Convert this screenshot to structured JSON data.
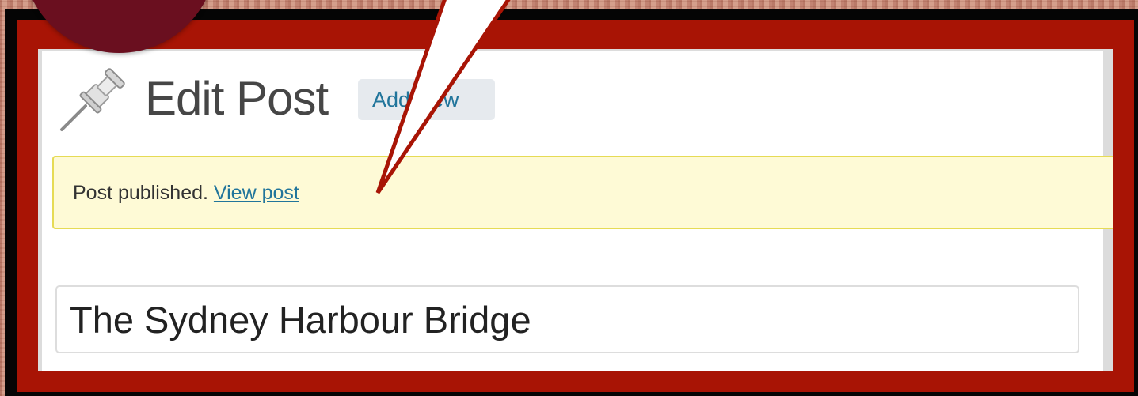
{
  "header": {
    "title": "Edit Post",
    "add_new_label": "Add New",
    "icon": "pushpin-icon"
  },
  "notice": {
    "message": "Post published.",
    "link_label": "View post"
  },
  "post": {
    "title_value": "The Sydney Harbour Bridge"
  },
  "colors": {
    "frame_red": "#a81405",
    "step_circle": "#6a0f1f",
    "link_blue": "#21759b",
    "notice_yellow": "#fefad6"
  }
}
